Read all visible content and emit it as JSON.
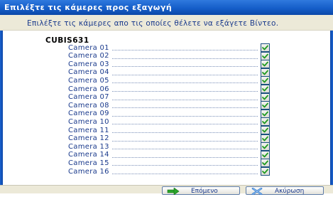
{
  "window": {
    "title": "Επιλέξτε τις κάμερες προς εξαγωγή",
    "subtitle": "Επιλέξτε τις κάμερες απο τις οποίες θέλετε να εξάγετε Βίντεο."
  },
  "group": {
    "name": "CUBIS631",
    "cameras": [
      {
        "label": "Camera 01",
        "checked": true
      },
      {
        "label": "Camera 02",
        "checked": true
      },
      {
        "label": "Camera 03",
        "checked": true
      },
      {
        "label": "Camera 04",
        "checked": true
      },
      {
        "label": "Camera 05",
        "checked": true
      },
      {
        "label": "Camera 06",
        "checked": true
      },
      {
        "label": "Camera 07",
        "checked": true
      },
      {
        "label": "Camera 08",
        "checked": true
      },
      {
        "label": "Camera 09",
        "checked": true
      },
      {
        "label": "Camera 10",
        "checked": true
      },
      {
        "label": "Camera 11",
        "checked": true
      },
      {
        "label": "Camera 12",
        "checked": true
      },
      {
        "label": "Camera 13",
        "checked": true
      },
      {
        "label": "Camera 14",
        "checked": true
      },
      {
        "label": "Camera 15",
        "checked": true
      },
      {
        "label": "Camera 16",
        "checked": true
      }
    ]
  },
  "buttons": {
    "next_label": "Επόμενο",
    "cancel_label": "Ακύρωση"
  },
  "icons": {
    "next": "arrow-right-icon",
    "cancel": "close-x-icon",
    "check": "checkmark-icon"
  },
  "colors": {
    "titlebar": "#155ec9",
    "label_text": "#1a3a8c",
    "checkmark": "#1f9a1f"
  }
}
